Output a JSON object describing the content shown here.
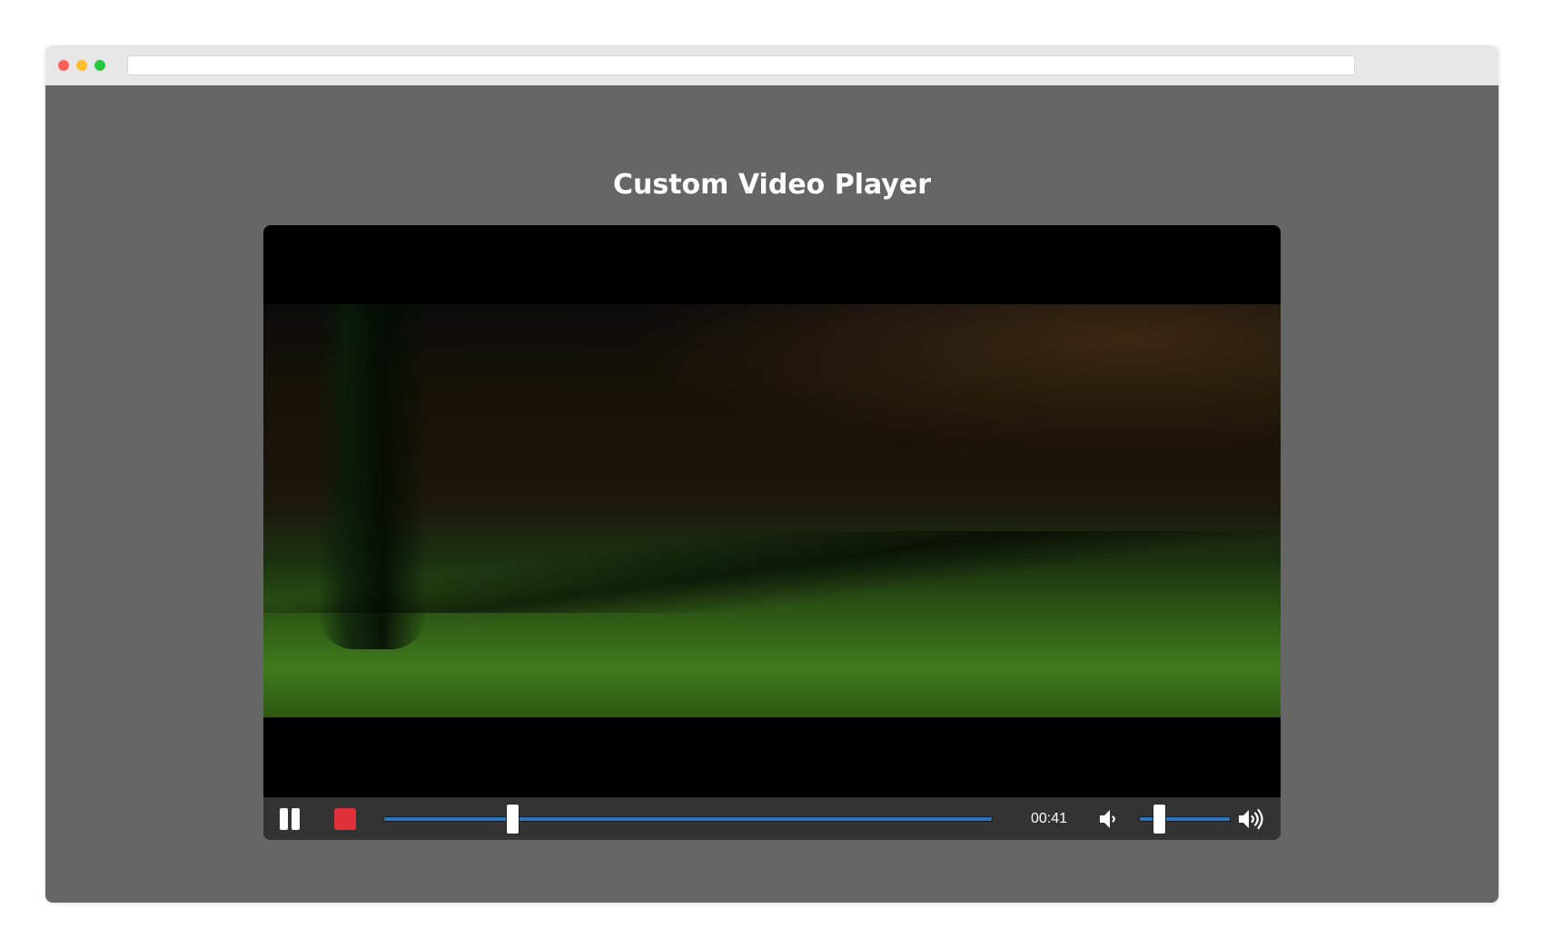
{
  "page": {
    "title": "Custom Video Player"
  },
  "player": {
    "current_time": "00:41",
    "progress_fraction": 0.213,
    "volume_fraction": 0.22
  },
  "controls": {
    "pause_icon": "pause-icon",
    "stop_icon": "stop-icon",
    "volume_down_icon": "volume-down-icon",
    "volume_up_icon": "volume-up-icon"
  },
  "colors": {
    "page_background": "#666666",
    "controls_background": "#333333",
    "stop_button": "#e0303a",
    "slider_track": "#2d74bd"
  }
}
